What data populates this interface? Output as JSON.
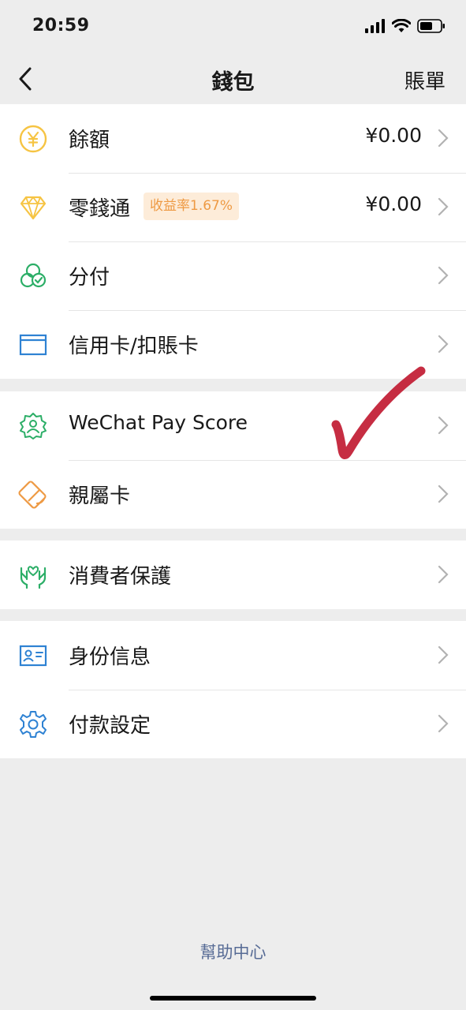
{
  "status": {
    "time": "20:59"
  },
  "nav": {
    "title": "錢包",
    "bill": "賬單"
  },
  "groups": [
    [
      {
        "label": "餘額",
        "value": "¥0.00",
        "icon": "yuan-coin-icon"
      },
      {
        "label": "零錢通",
        "badge": "收益率1.67%",
        "value": "¥0.00",
        "icon": "diamond-icon"
      },
      {
        "label": "分付",
        "icon": "fenfu-icon"
      },
      {
        "label": "信用卡/扣賬卡",
        "icon": "bank-card-icon"
      }
    ],
    [
      {
        "label": "WeChat Pay Score",
        "icon": "pay-score-icon"
      },
      {
        "label": "親屬卡",
        "icon": "family-card-icon"
      }
    ],
    [
      {
        "label": "消費者保護",
        "icon": "protection-hands-icon"
      }
    ],
    [
      {
        "label": "身份信息",
        "icon": "id-card-icon"
      },
      {
        "label": "付款設定",
        "icon": "settings-gear-icon"
      }
    ]
  ],
  "footer": {
    "help": "幫助中心"
  },
  "colors": {
    "yellow": "#f6c443",
    "green": "#2cae67",
    "blue": "#2e82d3",
    "orange": "#ee9a44",
    "link": "#576b95",
    "check": "#c0162e"
  }
}
